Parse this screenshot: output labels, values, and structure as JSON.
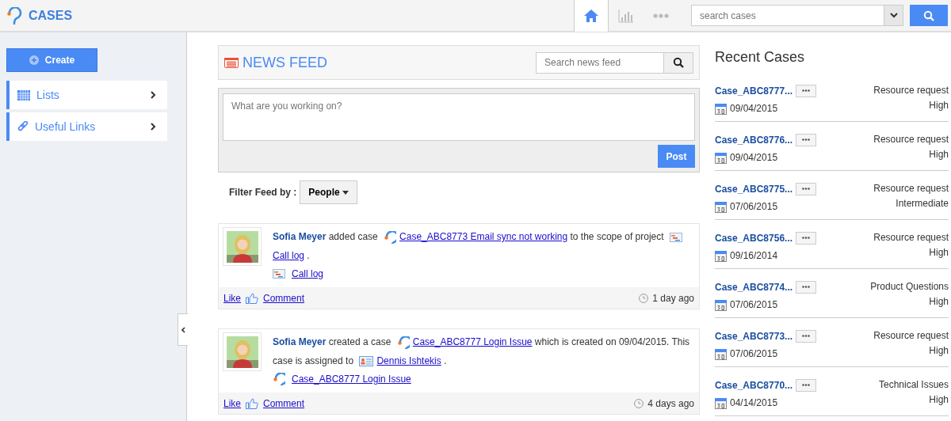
{
  "app": {
    "title": "CASES"
  },
  "toolbar": {
    "tabs": [
      {
        "kind": "home",
        "selected": true
      },
      {
        "kind": "chart",
        "selected": false
      },
      {
        "kind": "more",
        "selected": false
      }
    ],
    "search": {
      "placeholder": "search cases"
    }
  },
  "sidebar": {
    "create": "Create",
    "items": [
      {
        "kind": "grid",
        "label": "Lists"
      },
      {
        "kind": "link",
        "label": "Useful Links"
      }
    ]
  },
  "news_feed": {
    "title": "NEWS FEED",
    "search": {
      "placeholder": "Search news feed"
    },
    "composer": {
      "placeholder": "What are you working on?",
      "button": "Post"
    },
    "filter": {
      "label": "Filter Feed by :",
      "button": "People"
    },
    "items": [
      {
        "segments": [
          {
            "kind": "author",
            "text": "Sofia Meyer"
          },
          {
            "kind": "text",
            "text": " added case "
          },
          {
            "kind": "case_link",
            "text": "Case_ABC8773 Email sync not working"
          },
          {
            "kind": "text",
            "text": " to the scope of project "
          },
          {
            "kind": "project_link",
            "text": "Call log"
          },
          {
            "kind": "text",
            "text": " ."
          }
        ],
        "attachment": {
          "kind": "project",
          "text": "Call log"
        },
        "like": "Like",
        "comment": "Comment",
        "time": "1 day ago"
      },
      {
        "segments": [
          {
            "kind": "author",
            "text": "Sofia Meyer"
          },
          {
            "kind": "text",
            "text": " created a case "
          },
          {
            "kind": "case_link",
            "text": "Case_ABC8777 Login Issue"
          },
          {
            "kind": "text",
            "text": " which is created on 09/04/2015. This case is assigned to "
          },
          {
            "kind": "user_link",
            "text": "Dennis Ishtekis"
          },
          {
            "kind": "text",
            "text": " ."
          }
        ],
        "attachment": {
          "kind": "case",
          "text": "Case_ABC8777 Login Issue"
        },
        "like": "Like",
        "comment": "Comment",
        "time": "4 days ago"
      }
    ]
  },
  "recent_cases": {
    "title": "Recent Cases",
    "rows": [
      {
        "case": "Case_ABC8777...",
        "date": "09/04/2015",
        "category": "Resource request",
        "priority": "High"
      },
      {
        "case": "Case_ABC8776...",
        "date": "09/04/2015",
        "category": "Resource request",
        "priority": "High"
      },
      {
        "case": "Case_ABC8775...",
        "date": "07/06/2015",
        "category": "Resource request",
        "priority": "Intermediate"
      },
      {
        "case": "Case_ABC8756...",
        "date": "09/16/2014",
        "category": "Resource request",
        "priority": "High"
      },
      {
        "case": "Case_ABC8774...",
        "date": "07/06/2015",
        "category": "Product Questions",
        "priority": "High"
      },
      {
        "case": "Case_ABC8773...",
        "date": "07/06/2015",
        "category": "Resource request",
        "priority": "High"
      },
      {
        "case": "Case_ABC8770...",
        "date": "04/14/2015",
        "category": "Technical Issues",
        "priority": "High"
      }
    ]
  }
}
